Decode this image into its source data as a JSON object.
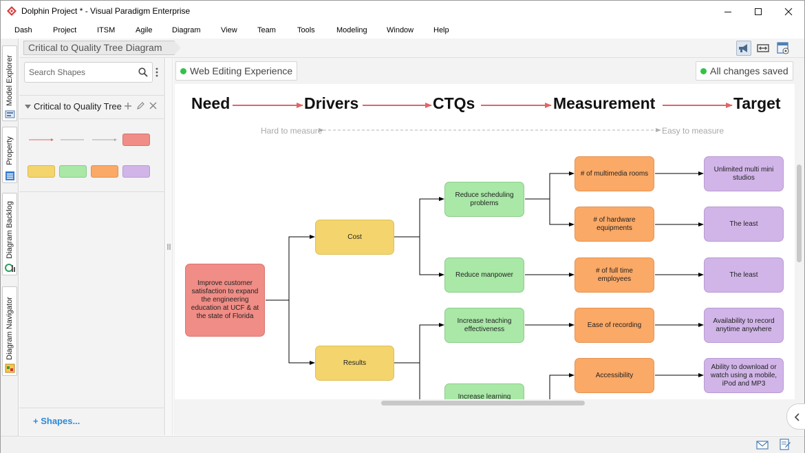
{
  "window": {
    "title": "Dolphin Project * - Visual Paradigm Enterprise",
    "controls": [
      "minimize",
      "maximize",
      "close"
    ]
  },
  "menu": [
    "Dash",
    "Project",
    "ITSM",
    "Agile",
    "Diagram",
    "View",
    "Team",
    "Tools",
    "Modeling",
    "Window",
    "Help"
  ],
  "side_tabs": [
    "Model Explorer",
    "Property",
    "Diagram Backlog",
    "Diagram Navigator"
  ],
  "breadcrumb": "Critical to Quality Tree Diagram",
  "left_panel": {
    "search_placeholder": "Search Shapes",
    "stencil_title": "Critical to Quality Tree",
    "shapes_link": "+ Shapes..."
  },
  "canvas": {
    "status_left": "Web Editing Experience",
    "status_right": "All changes saved"
  },
  "diagram": {
    "headers": [
      "Need",
      "Drivers",
      "CTQs",
      "Measurement",
      "Target"
    ],
    "hard_label": "Hard to measure",
    "easy_label": "Easy to measure",
    "need": "Improve customer satisfaction to expand the engineering education at UCF & at the state of Florida",
    "drivers": [
      "Cost",
      "Results"
    ],
    "ctqs": [
      "Reduce scheduling problems",
      "Reduce manpower",
      "Increase teaching effectiveness",
      "Increase learning"
    ],
    "measurements": [
      "# of multimedia rooms",
      "# of hardware equipments",
      "# of full time employees",
      "Ease of recording",
      "Accessibility"
    ],
    "targets": [
      "Unlimited multi mini studios",
      "The least",
      "The least",
      "Availability to record anytime anywhere",
      "Ability to download or watch using a mobile, iPod and MP3"
    ]
  },
  "colors": {
    "header_arrow": "#e06666",
    "need": "#f08d86",
    "driver": "#f4d56d",
    "ctq": "#a9e8a7",
    "measurement": "#fba966",
    "target": "#d1b5e8",
    "saved_dot": "#34c14a",
    "link": "#2c8ad8"
  }
}
